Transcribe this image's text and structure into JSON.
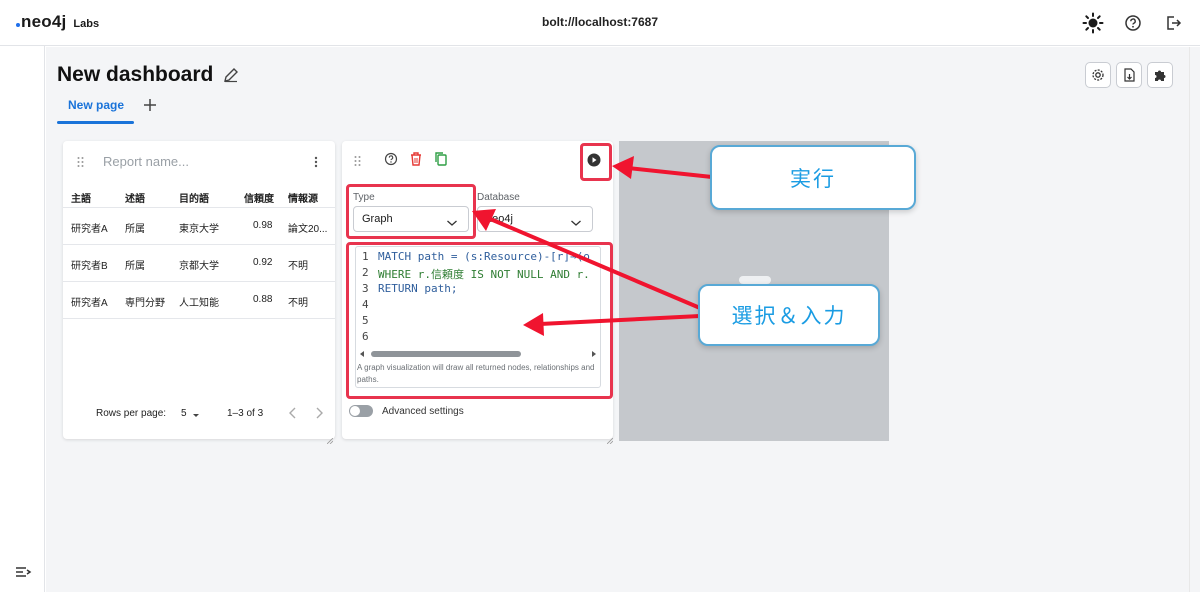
{
  "topbar": {
    "logo_text": "neo4j",
    "logo_labs": "Labs",
    "connection": "bolt://localhost:7687"
  },
  "dashboard": {
    "title": "New dashboard",
    "tabs": [
      {
        "label": "New page",
        "active": true
      }
    ]
  },
  "report": {
    "name_placeholder": "Report name...",
    "columns": [
      "主語",
      "述語",
      "目的語",
      "信頼度",
      "情報源"
    ],
    "rows": [
      [
        "研究者A",
        "所属",
        "東京大学",
        "0.98",
        "論文20..."
      ],
      [
        "研究者B",
        "所属",
        "京都大学",
        "0.92",
        "不明"
      ],
      [
        "研究者A",
        "専門分野",
        "人工知能",
        "0.88",
        "不明"
      ]
    ],
    "rows_per_page_label": "Rows per page:",
    "rows_per_page_value": "5",
    "range": "1–3 of 3"
  },
  "editor": {
    "type_label": "Type",
    "type_value": "Graph",
    "database_label": "Database",
    "database_value": "neo4j",
    "code_lines": [
      {
        "n": "1",
        "text": "MATCH path = (s:Resource)-[r]→(o"
      },
      {
        "n": "2",
        "text": "WHERE r.信頼度 IS NOT NULL AND r."
      },
      {
        "n": "3",
        "text": "RETURN path;"
      },
      {
        "n": "4",
        "text": ""
      },
      {
        "n": "5",
        "text": ""
      },
      {
        "n": "6",
        "text": ""
      }
    ],
    "helper_text": "A graph visualization will draw all returned nodes, relationships and paths.",
    "advanced_label": "Advanced settings",
    "advanced_enabled": false
  },
  "annotations": {
    "run_callout": "実行",
    "select_callout": "選択＆入力",
    "highlight_color": "#e8344e",
    "callout_color": "#1a9ce3"
  },
  "colors": {
    "accent": "#1a73d9"
  },
  "icons": {
    "theme": "sun-icon",
    "help": "help-circle-icon",
    "logout": "logout-icon",
    "settings": "gear-icon",
    "export": "file-export-icon",
    "extensions": "puzzle-icon"
  }
}
